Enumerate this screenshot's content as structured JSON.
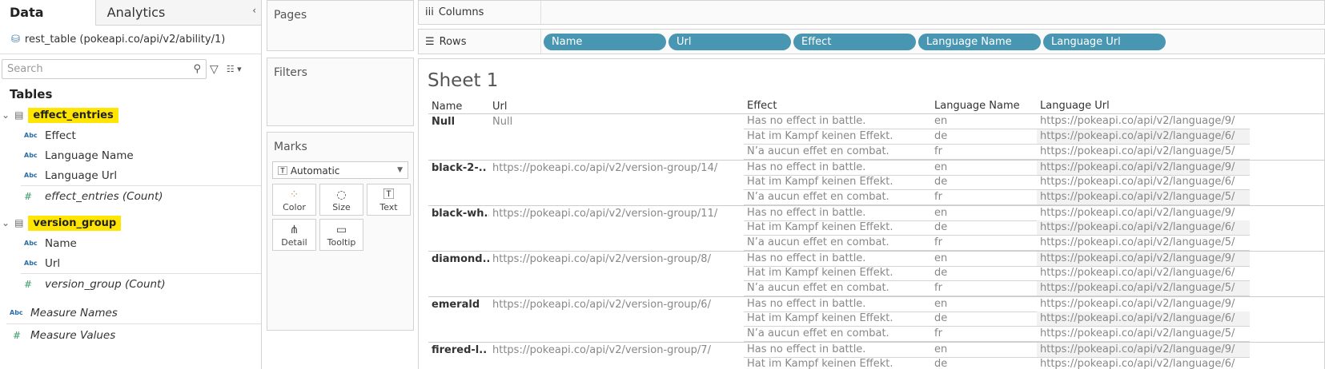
{
  "left": {
    "tabs": [
      "Data",
      "Analytics"
    ],
    "datasource": "rest_table (pokeapi.co/api/v2/ability/1)",
    "search_placeholder": "Search",
    "tables_heading": "Tables",
    "groups": [
      {
        "name": "effect_entries",
        "fields": [
          "Effect",
          "Language Name",
          "Language Url"
        ],
        "count": "effect_entries (Count)"
      },
      {
        "name": "version_group",
        "fields": [
          "Name",
          "Url"
        ],
        "count": "version_group (Count)"
      }
    ],
    "measure_names": "Measure Names",
    "measure_values": "Measure Values"
  },
  "middle": {
    "pages": "Pages",
    "filters": "Filters",
    "marks": "Marks",
    "mark_type": "Automatic",
    "buttons": [
      "Color",
      "Size",
      "Text",
      "Detail",
      "Tooltip"
    ]
  },
  "shelves": {
    "columns": "Columns",
    "rows": "Rows",
    "row_pills": [
      "Name",
      "Url",
      "Effect",
      "Language Name",
      "Language Url"
    ]
  },
  "sheet": {
    "title": "Sheet 1",
    "headers": [
      "Name",
      "Url",
      "Effect",
      "Language Name",
      "Language Url"
    ],
    "groups": [
      {
        "name": "Null",
        "url": "Null"
      },
      {
        "name": "black-2-..",
        "url": "https://pokeapi.co/api/v2/version-group/14/"
      },
      {
        "name": "black-wh..",
        "url": "https://pokeapi.co/api/v2/version-group/11/"
      },
      {
        "name": "diamond..",
        "url": "https://pokeapi.co/api/v2/version-group/8/"
      },
      {
        "name": "emerald",
        "url": "https://pokeapi.co/api/v2/version-group/6/"
      },
      {
        "name": "firered-l..",
        "url": "https://pokeapi.co/api/v2/version-group/7/"
      }
    ],
    "entries": [
      {
        "effect": "Has no effect in battle.",
        "lang": "en",
        "lang_url": "https://pokeapi.co/api/v2/language/9/"
      },
      {
        "effect": "Hat im Kampf keinen Effekt.",
        "lang": "de",
        "lang_url": "https://pokeapi.co/api/v2/language/6/"
      },
      {
        "effect": "N’a aucun effet en combat.",
        "lang": "fr",
        "lang_url": "https://pokeapi.co/api/v2/language/5/"
      }
    ]
  }
}
